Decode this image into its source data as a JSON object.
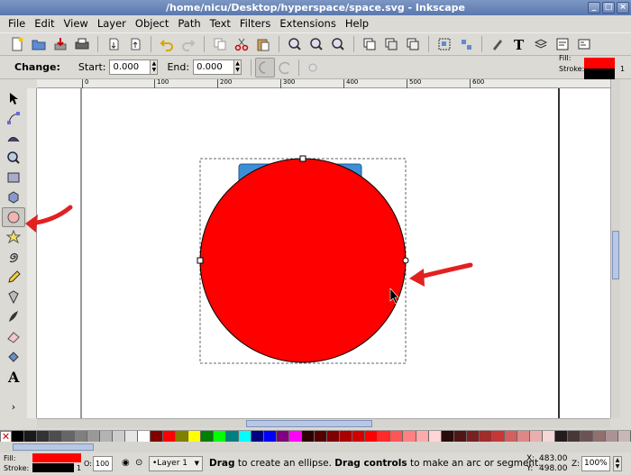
{
  "window": {
    "title": "/home/nicu/Desktop/hyperspace/space.svg - Inkscape"
  },
  "menu": [
    "File",
    "Edit",
    "View",
    "Layer",
    "Object",
    "Path",
    "Text",
    "Filters",
    "Extensions",
    "Help"
  ],
  "tool_controls": {
    "title": "Change:",
    "start_label": "Start:",
    "start_value": "0.000",
    "end_label": "End:",
    "end_value": "0.000"
  },
  "style_indicator": {
    "fill_label": "Fill:",
    "stroke_label": "Stroke:",
    "stroke_width": "1",
    "fill_color": "#ff0000",
    "stroke_color": "#000000"
  },
  "ruler_ticks": [
    "0",
    "100",
    "200",
    "300",
    "400",
    "500",
    "600"
  ],
  "status": {
    "fill_label": "Fill:",
    "stroke_label": "Stroke:",
    "stroke_width": "1",
    "opacity_label": "O:",
    "opacity_value": "100",
    "layer": "•Layer 1",
    "message_bold1": "Drag",
    "message_text1": " to create an ellipse. ",
    "message_bold2": "Drag controls",
    "message_text2": " to make an arc or segment.",
    "x_label": "X:",
    "x_value": "483.00",
    "y_label": "Y:",
    "y_value": "498.00",
    "zoom_label": "Z:",
    "zoom_value": "100%"
  },
  "colors": {
    "ellipse_fill": "#ff0000",
    "back_rect": "#3c8fd6",
    "annotation_arrow": "#e32020"
  },
  "palette": [
    "#000000",
    "#1a1a1a",
    "#333333",
    "#4d4d4d",
    "#666666",
    "#808080",
    "#999999",
    "#b3b3b3",
    "#cccccc",
    "#e6e6e6",
    "#ffffff",
    "#800000",
    "#ff0000",
    "#808000",
    "#ffff00",
    "#008000",
    "#00ff00",
    "#008080",
    "#00ffff",
    "#000080",
    "#0000ff",
    "#800080",
    "#ff00ff",
    "#2b0000",
    "#550000",
    "#800000",
    "#aa0000",
    "#d40000",
    "#ff0000",
    "#ff2a2a",
    "#ff5555",
    "#ff8080",
    "#ffaaaa",
    "#ffd5d5",
    "#280b0b",
    "#501616",
    "#782121",
    "#a02c2c",
    "#c83737",
    "#d35f5f",
    "#de8787",
    "#e9afaf",
    "#f4d7d7",
    "#241c1c",
    "#483737",
    "#6c5353",
    "#916f6f",
    "#ac9393",
    "#c8b7b7"
  ]
}
